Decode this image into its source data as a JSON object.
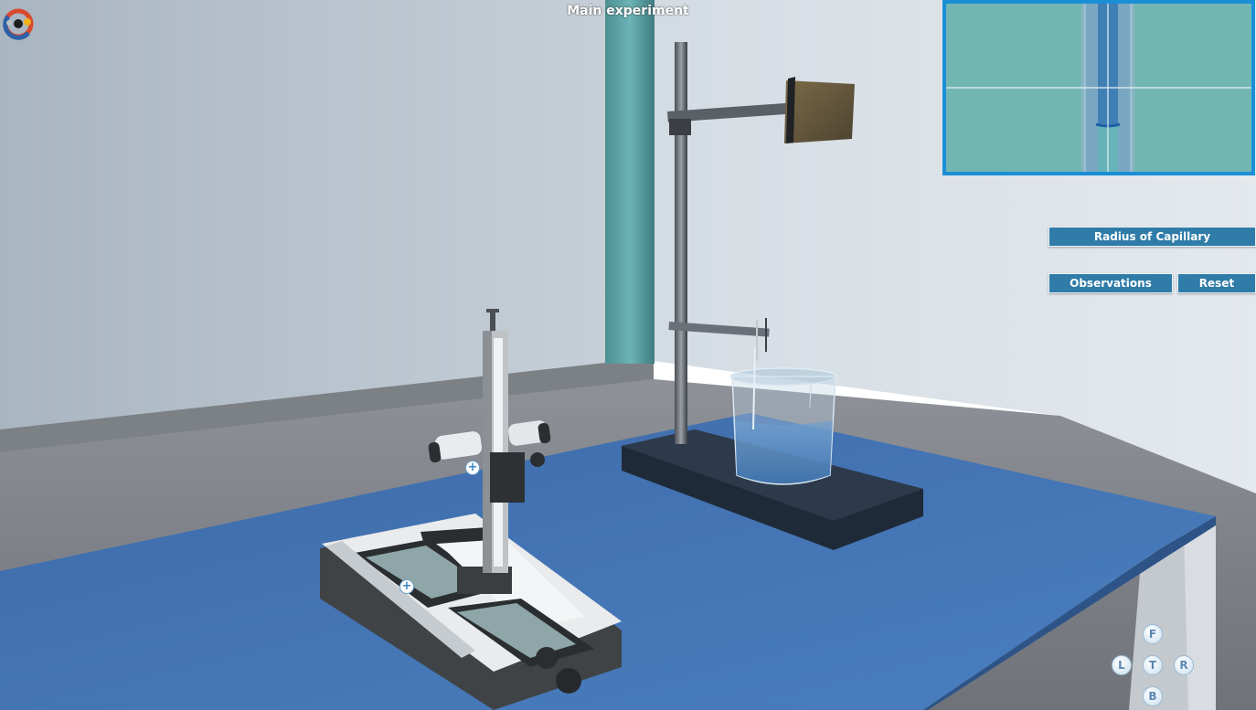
{
  "header": {
    "title": "Main experiment"
  },
  "buttons": {
    "radius": "Radius of Capillary",
    "observations": "Observations",
    "reset": "Reset"
  },
  "camera_controls": {
    "front": "F",
    "left": "L",
    "top": "T",
    "right": "R",
    "back": "B"
  },
  "icons": {
    "logo": "app-logo-icon",
    "zoom": "zoom-plus-icon"
  },
  "colors": {
    "accent": "#1a8fd6",
    "button": "#2f7ca8",
    "table": "#3f73b6"
  }
}
